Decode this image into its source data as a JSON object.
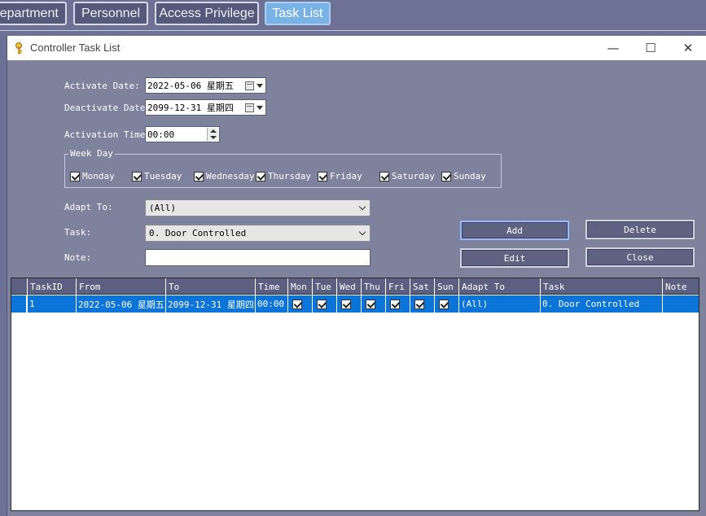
{
  "top_tabs": [
    {
      "label": "Department",
      "active": false
    },
    {
      "label": "Personnel",
      "active": false
    },
    {
      "label": "Access Privilege",
      "active": false
    },
    {
      "label": "Task List",
      "active": true
    }
  ],
  "window": {
    "title": "Controller Task List",
    "minimize": "—",
    "maximize": "☐",
    "close": "✕"
  },
  "form": {
    "activate_label": "Activate Date:",
    "activate_value": "2022-05-06 星期五",
    "deactivate_label": "Deactivate Date:",
    "deactivate_value": "2099-12-31 星期四",
    "time_label": "Activation Time:",
    "time_value": "00:00",
    "weekday_legend": "Week Day",
    "days": [
      "Monday",
      "Tuesday",
      "Wednesday",
      "Thursday",
      "Friday",
      "Saturday",
      "Sunday"
    ],
    "adapt_label": "Adapt To:",
    "adapt_value": "(All)",
    "task_label": "Task:",
    "task_value": "0. Door Controlled",
    "note_label": "Note:",
    "note_value": ""
  },
  "buttons": {
    "add": "Add",
    "delete": "Delete",
    "edit": "Edit",
    "close": "Close"
  },
  "grid": {
    "columns": [
      "TaskID",
      "From",
      "To",
      "Time",
      "Mon",
      "Tue",
      "Wed",
      "Thu",
      "Fri",
      "Sat",
      "Sun",
      "Adapt To",
      "Task",
      "Note"
    ],
    "rows": [
      {
        "taskid": "1",
        "from": "2022-05-06 星期五",
        "to": "2099-12-31 星期四",
        "time": "00:00",
        "mon": true,
        "tue": true,
        "wed": true,
        "thu": true,
        "fri": true,
        "sat": true,
        "sun": true,
        "adapt": "(All)",
        "task": "0. Door Controlled",
        "note": ""
      }
    ]
  }
}
